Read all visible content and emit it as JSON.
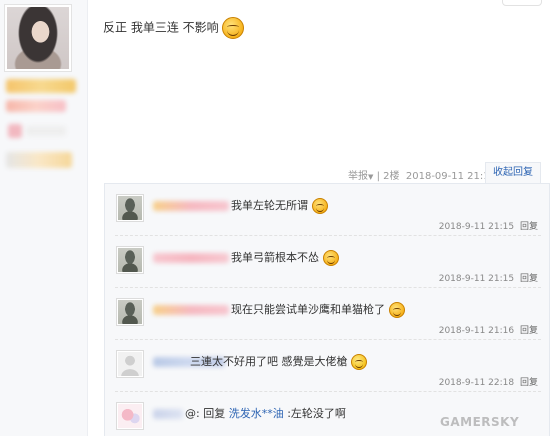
{
  "post": {
    "text": "反正 我单三连 不影响",
    "meta": {
      "report_label": "举报",
      "separator": "|",
      "floor": "2楼",
      "timestamp": "2018-09-11 21:10"
    },
    "collapse_label": "收起回复"
  },
  "replies": [
    {
      "text": "我单左轮无所谓",
      "time": "2018-9-11 21:15",
      "reply_label": "回复",
      "emoticon": "grin-emoticon-icon"
    },
    {
      "text": "我单弓箭根本不怂",
      "time": "2018-9-11 21:15",
      "reply_label": "回复",
      "emoticon": "grin-emoticon-icon"
    },
    {
      "text": "现在只能尝试单沙鹰和单猫枪了",
      "time": "2018-9-11 21:16",
      "reply_label": "回复",
      "emoticon": "grin-emoticon-icon"
    },
    {
      "text": "三連太不好用了吧 感覺是大佬槍",
      "time": "2018-9-11 22:18",
      "reply_label": "回复",
      "emoticon": "sweat-emoticon-icon"
    },
    {
      "at_symbol": "@",
      "prefix": ": 回复",
      "mention": "洗发水**油",
      "suffix": " :左轮没了啊"
    }
  ],
  "watermark": "GAMERSKY",
  "colors": {
    "link": "#2d64b3",
    "panel_bg": "#f7f8fa",
    "meta_text": "#999999"
  }
}
